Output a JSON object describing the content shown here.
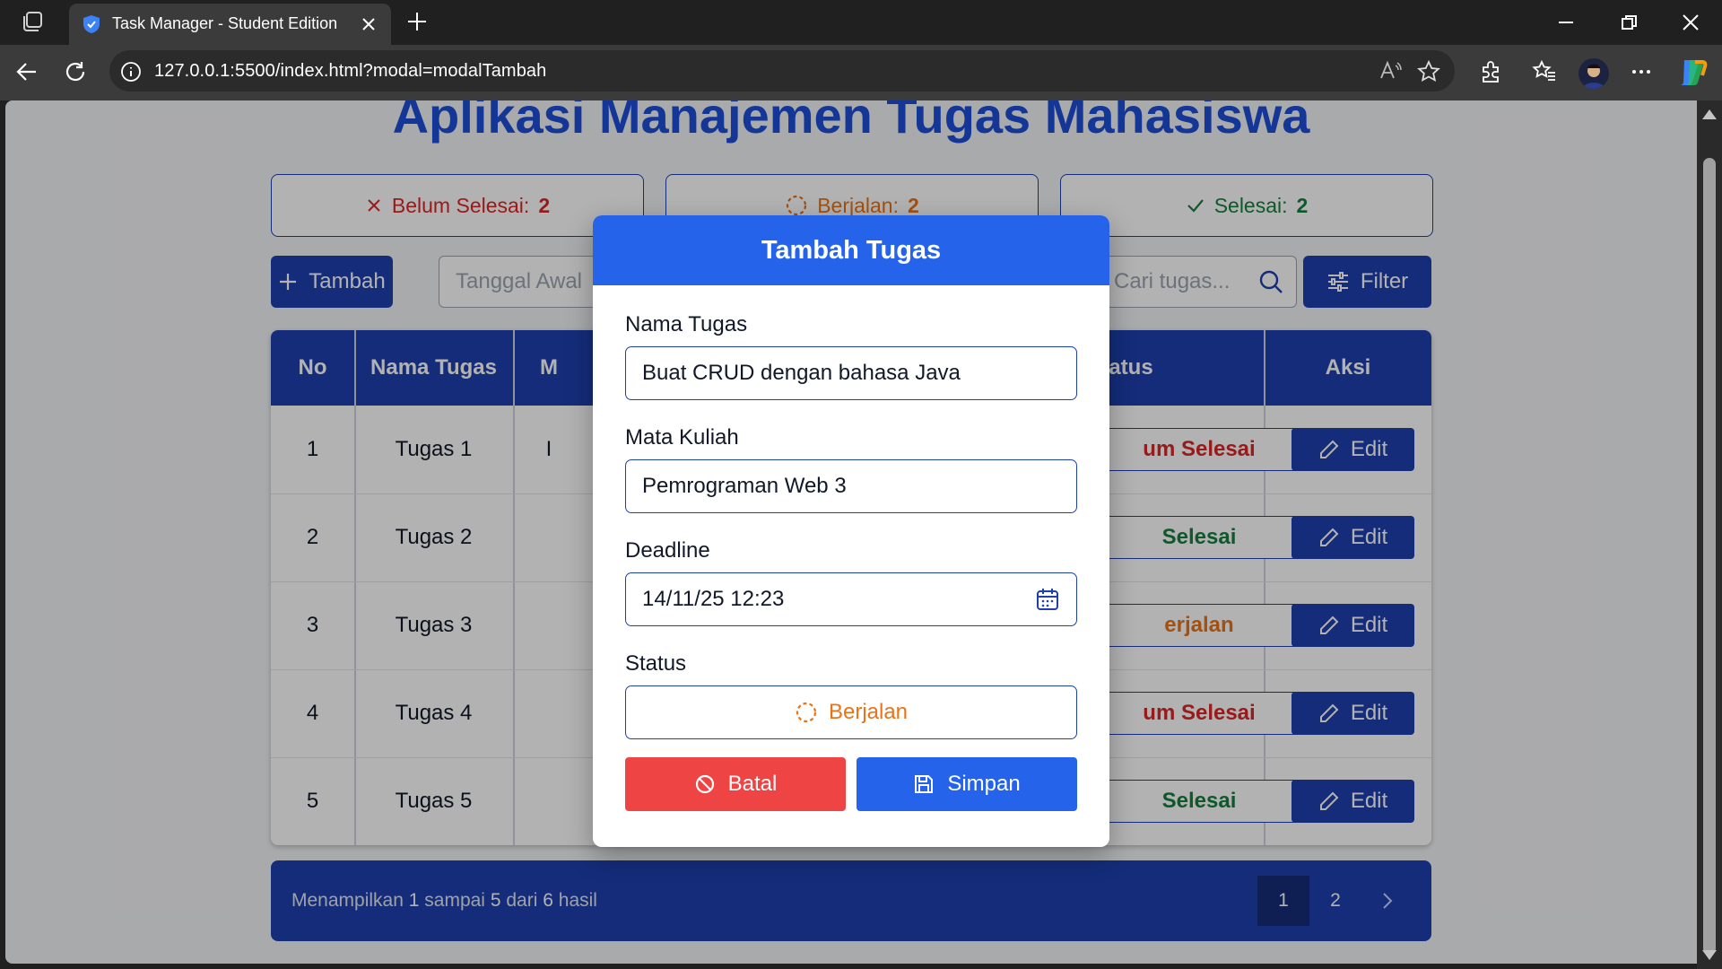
{
  "browser": {
    "tab_title": "Task Manager - Student Edition",
    "url": "127.0.0.1:5500/index.html?modal=modalTambah"
  },
  "app": {
    "title": "Aplikasi Manajemen Tugas Mahasiswa",
    "stats": [
      {
        "label": "Belum Selesai:",
        "count": "2",
        "color": "#dc2626",
        "icon": "x-icon"
      },
      {
        "label": "Berjalan:",
        "count": "2",
        "color": "#ea7317",
        "icon": "spinner-icon"
      },
      {
        "label": "Selesai:",
        "count": "2",
        "color": "#15803d",
        "icon": "check-icon"
      }
    ],
    "toolbar": {
      "add_label": "Tambah",
      "date_placeholder": "Tanggal Awal",
      "search_placeholder": "Cari tugas...",
      "filter_label": "Filter"
    },
    "table": {
      "headers": {
        "no": "No",
        "name": "Nama Tugas",
        "course_partial": "M",
        "status_partial": "tatus",
        "actions": "Aksi"
      },
      "rows": [
        {
          "no": "1",
          "name": "Tugas 1",
          "course_partial": "I",
          "status_partial": "um Selesai",
          "status_color": "#dc2626",
          "edit": "Edit"
        },
        {
          "no": "2",
          "name": "Tugas 2",
          "course_partial": "",
          "status_partial": "Selesai",
          "status_color": "#15803d",
          "edit": "Edit"
        },
        {
          "no": "3",
          "name": "Tugas 3",
          "course_partial": "",
          "status_partial": "erjalan",
          "status_color": "#ea7317",
          "edit": "Edit"
        },
        {
          "no": "4",
          "name": "Tugas 4",
          "course_partial": "",
          "status_partial": "um Selesai",
          "status_color": "#dc2626",
          "edit": "Edit"
        },
        {
          "no": "5",
          "name": "Tugas 5",
          "course_partial": "",
          "status_partial": "Selesai",
          "status_color": "#15803d",
          "edit": "Edit"
        }
      ]
    },
    "pagination": {
      "prefix": "Menampilkan",
      "from": "1",
      "mid1": "sampai",
      "to": "5",
      "mid2": "dari",
      "total": "6",
      "suffix": "hasil",
      "pages": [
        "1",
        "2"
      ],
      "current": "1"
    }
  },
  "modal": {
    "title": "Tambah Tugas",
    "name_label": "Nama Tugas",
    "name_value": "Buat CRUD dengan bahasa Java",
    "course_label": "Mata Kuliah",
    "course_value": "Pemrograman Web 3",
    "deadline_label": "Deadline",
    "deadline_value": "14/11/25 12:23",
    "status_label": "Status",
    "status_value": "Berjalan",
    "status_color": "#ea7317",
    "cancel_label": "Batal",
    "save_label": "Simpan"
  },
  "colors": {
    "primary": "#1e40af",
    "modal_primary": "#2563eb",
    "danger": "#ef4444"
  }
}
